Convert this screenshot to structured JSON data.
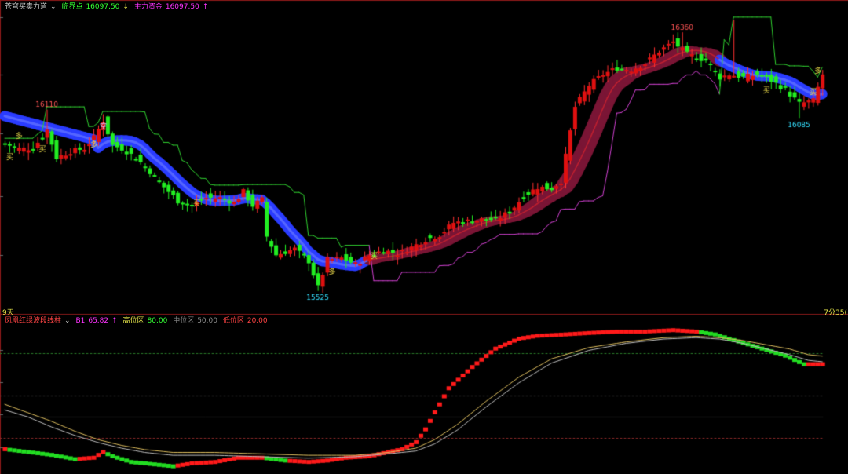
{
  "upper_panel": {
    "indicator_name": "苍穹买卖力道",
    "dropdown_icon": "chevron-down-icon",
    "critical_label": "临界点",
    "critical_value": "16097.50",
    "capital_label": "主力资金",
    "capital_value": "16097.50",
    "capital_arrow": "↑",
    "left_edge_label": "9天",
    "right_edge_label": "7分35("
  },
  "lower_panel": {
    "indicator_name": "凤凰红绿波段线柱",
    "dropdown_icon": "chevron-down-icon",
    "b1_label": "B1",
    "b1_value": "65.82",
    "b1_arrow": "↑",
    "high_label": "高位区",
    "high_value": "80.00",
    "mid_label": "中位区",
    "mid_value": "50.00",
    "low_label": "低位区",
    "low_value": "20.00"
  },
  "colors": {
    "up": "#ff2020",
    "down": "#22ee22",
    "ribbon_down": "#2a3cff",
    "ribbon_up": "#7a1535",
    "stop_line_up": "#d040d0",
    "stop_line_down": "#30d030",
    "label_cyan": "#35e0ff",
    "label_red": "#ff5555",
    "signal_yellow": "#e8d84a"
  },
  "chart_data": [
    {
      "type": "candlestick",
      "title": "苍穹买卖力道",
      "y_range": [
        15470,
        16430
      ],
      "price_labels": [
        {
          "text": "16110",
          "value": 16110,
          "bar": 9
        },
        {
          "text": "15525",
          "value": 15525,
          "bar": 67
        },
        {
          "text": "16360",
          "value": 16360,
          "bar": 145
        },
        {
          "text": "16085",
          "value": 16085,
          "bar": 170
        }
      ],
      "signal_marks": [
        {
          "text": "买",
          "bar": 1,
          "value": 15960
        },
        {
          "text": "多",
          "bar": 3,
          "value": 16030
        },
        {
          "text": "买",
          "bar": 8,
          "value": 15985
        },
        {
          "text": "多",
          "bar": 19,
          "value": 16000
        },
        {
          "text": "空",
          "bar": 21,
          "value": 16060
        },
        {
          "text": "买",
          "bar": 41,
          "value": 15810
        },
        {
          "text": "多",
          "bar": 70,
          "value": 15590
        },
        {
          "text": "买",
          "bar": 79,
          "value": 15640
        },
        {
          "text": "买",
          "bar": 163,
          "value": 16175
        },
        {
          "text": "多",
          "bar": 174,
          "value": 16240
        },
        {
          "text": "买",
          "bar": 173,
          "value": 16170
        }
      ],
      "trend_segments": [
        {
          "name": "down",
          "start": 0,
          "end": 78
        },
        {
          "name": "up",
          "start": 78,
          "end": 153
        },
        {
          "name": "down",
          "start": 153,
          "end": 176
        }
      ],
      "close_anchors": [
        [
          0,
          16000
        ],
        [
          3,
          15985
        ],
        [
          6,
          15985
        ],
        [
          9,
          16045
        ],
        [
          11,
          15955
        ],
        [
          14,
          15975
        ],
        [
          17,
          15985
        ],
        [
          19,
          16020
        ],
        [
          21,
          16075
        ],
        [
          23,
          15995
        ],
        [
          25,
          15985
        ],
        [
          28,
          15955
        ],
        [
          31,
          15910
        ],
        [
          34,
          15860
        ],
        [
          37,
          15815
        ],
        [
          40,
          15800
        ],
        [
          43,
          15825
        ],
        [
          46,
          15825
        ],
        [
          49,
          15810
        ],
        [
          51,
          15845
        ],
        [
          53,
          15800
        ],
        [
          55,
          15820
        ],
        [
          56,
          15700
        ],
        [
          58,
          15640
        ],
        [
          62,
          15660
        ],
        [
          65,
          15620
        ],
        [
          67,
          15535
        ],
        [
          69,
          15625
        ],
        [
          72,
          15630
        ],
        [
          75,
          15610
        ],
        [
          78,
          15640
        ],
        [
          81,
          15655
        ],
        [
          84,
          15645
        ],
        [
          87,
          15665
        ],
        [
          90,
          15690
        ],
        [
          93,
          15705
        ],
        [
          96,
          15745
        ],
        [
          99,
          15750
        ],
        [
          102,
          15755
        ],
        [
          105,
          15755
        ],
        [
          108,
          15780
        ],
        [
          111,
          15830
        ],
        [
          114,
          15860
        ],
        [
          117,
          15855
        ],
        [
          119,
          15880
        ],
        [
          122,
          16120
        ],
        [
          125,
          16190
        ],
        [
          128,
          16225
        ],
        [
          131,
          16245
        ],
        [
          134,
          16240
        ],
        [
          137,
          16260
        ],
        [
          140,
          16300
        ],
        [
          143,
          16330
        ],
        [
          146,
          16290
        ],
        [
          150,
          16270
        ],
        [
          153,
          16215
        ],
        [
          155,
          16225
        ],
        [
          158,
          16215
        ],
        [
          161,
          16225
        ],
        [
          164,
          16205
        ],
        [
          167,
          16175
        ],
        [
          170,
          16130
        ],
        [
          173,
          16140
        ],
        [
          175,
          16225
        ]
      ]
    },
    {
      "type": "bar-line",
      "title": "凤凰红绿波段线柱",
      "y_range": [
        -3,
        100
      ],
      "reference_lines": [
        {
          "label": "高位区",
          "value": 80
        },
        {
          "label": "中位区",
          "value": 50
        },
        {
          "label": "低位区",
          "value": 20
        }
      ],
      "latest": {
        "B1": 65.82
      },
      "b1_anchors": [
        [
          0,
          12
        ],
        [
          5,
          10
        ],
        [
          10,
          8
        ],
        [
          15,
          5
        ],
        [
          19,
          6
        ],
        [
          21,
          10
        ],
        [
          23,
          7
        ],
        [
          27,
          3
        ],
        [
          33,
          1
        ],
        [
          36,
          0
        ],
        [
          40,
          2
        ],
        [
          45,
          3
        ],
        [
          50,
          6
        ],
        [
          55,
          6
        ],
        [
          60,
          4
        ],
        [
          65,
          3
        ],
        [
          69,
          4
        ],
        [
          73,
          6
        ],
        [
          78,
          7
        ],
        [
          82,
          10
        ],
        [
          85,
          12
        ],
        [
          88,
          17
        ],
        [
          90,
          26
        ],
        [
          92,
          38
        ],
        [
          95,
          55
        ],
        [
          100,
          70
        ],
        [
          105,
          83
        ],
        [
          110,
          90
        ],
        [
          114,
          92
        ],
        [
          120,
          93
        ],
        [
          125,
          94
        ],
        [
          131,
          95
        ],
        [
          137,
          95
        ],
        [
          143,
          96
        ],
        [
          148,
          95
        ],
        [
          152,
          93
        ],
        [
          157,
          88
        ],
        [
          162,
          83
        ],
        [
          167,
          78
        ],
        [
          171,
          72
        ],
        [
          175,
          72
        ]
      ],
      "line_series": [
        {
          "anchors": [
            [
              0,
              44
            ],
            [
              5,
              38
            ],
            [
              10,
              32
            ],
            [
              15,
              25
            ],
            [
              20,
              19
            ],
            [
              25,
              15
            ],
            [
              30,
              12
            ],
            [
              36,
              10
            ],
            [
              45,
              10
            ],
            [
              55,
              9
            ],
            [
              65,
              8
            ],
            [
              75,
              8
            ],
            [
              82,
              10
            ],
            [
              88,
              13
            ],
            [
              92,
              19
            ],
            [
              97,
              30
            ],
            [
              103,
              46
            ],
            [
              110,
              63
            ],
            [
              117,
              76
            ],
            [
              125,
              84
            ],
            [
              133,
              88
            ],
            [
              141,
              91
            ],
            [
              148,
              92
            ],
            [
              153,
              91
            ],
            [
              158,
              89
            ],
            [
              163,
              86
            ],
            [
              168,
              83
            ],
            [
              172,
              79
            ],
            [
              175,
              78
            ]
          ]
        },
        {
          "anchors": [
            [
              0,
              40
            ],
            [
              5,
              35
            ],
            [
              10,
              28
            ],
            [
              15,
              22
            ],
            [
              20,
              17
            ],
            [
              25,
              13
            ],
            [
              30,
              10
            ],
            [
              36,
              8
            ],
            [
              45,
              8
            ],
            [
              55,
              7
            ],
            [
              65,
              6
            ],
            [
              75,
              7
            ],
            [
              82,
              9
            ],
            [
              88,
              11
            ],
            [
              92,
              16
            ],
            [
              97,
              26
            ],
            [
              103,
              42
            ],
            [
              110,
              59
            ],
            [
              117,
              73
            ],
            [
              125,
              82
            ],
            [
              133,
              87
            ],
            [
              141,
              90
            ],
            [
              148,
              91
            ],
            [
              153,
              90
            ],
            [
              158,
              87
            ],
            [
              163,
              83
            ],
            [
              168,
              79
            ],
            [
              172,
              75
            ],
            [
              175,
              74
            ]
          ]
        }
      ]
    }
  ]
}
